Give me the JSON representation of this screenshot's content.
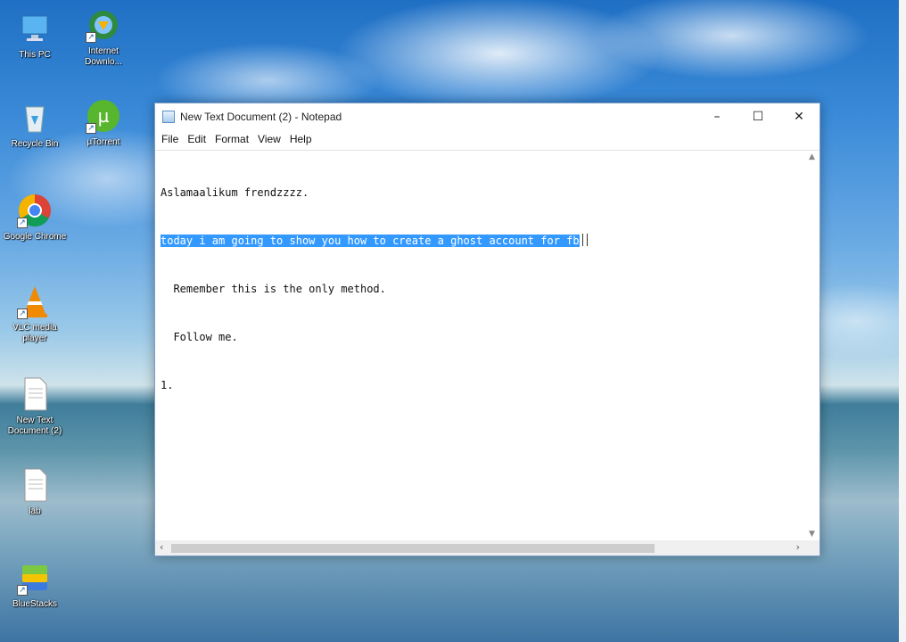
{
  "desktop": {
    "icons": [
      {
        "name": "this-pc-icon",
        "label": "This PC"
      },
      {
        "name": "internet-download-manager-icon",
        "label": "Internet Downlo..."
      },
      {
        "name": "recycle-bin-icon",
        "label": "Recycle Bin"
      },
      {
        "name": "utorrent-icon",
        "label": "µTorrent"
      },
      {
        "name": "google-chrome-icon",
        "label": "Google Chrome"
      },
      {
        "name": "vlc-media-player-icon",
        "label": "VLC media player"
      },
      {
        "name": "text-document-icon",
        "label": "New Text Document (2)"
      },
      {
        "name": "text-document-icon",
        "label": "lab"
      },
      {
        "name": "bluestacks-icon",
        "label": "BlueStacks"
      }
    ]
  },
  "notepad": {
    "title": "New Text Document (2) - Notepad",
    "menu": [
      "File",
      "Edit",
      "Format",
      "View",
      "Help"
    ],
    "lines": {
      "l1": "Aslamaalikum frendzzzz.",
      "l2": "today i am going to show you how to create a ghost account for fb",
      "l3": "  Remember this is the only method.",
      "l4": "  Follow me.",
      "l5": "1."
    },
    "controls": {
      "minimize": "–",
      "maximize": "☐",
      "close": "✕"
    },
    "scroll": {
      "up": "▲",
      "down": "▼",
      "left": "‹",
      "right": "›"
    }
  }
}
